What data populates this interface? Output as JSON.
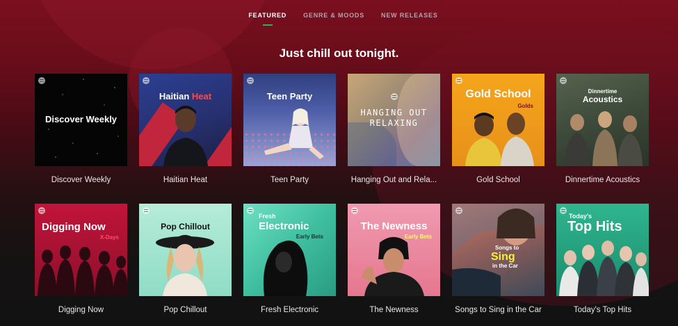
{
  "nav": {
    "tabs": [
      {
        "label": "FEATURED",
        "active": true
      },
      {
        "label": "GENRE & MOODS",
        "active": false
      },
      {
        "label": "NEW RELEASES",
        "active": false
      }
    ]
  },
  "headline": "Just chill out tonight.",
  "playlists": [
    {
      "name": "Discover Weekly",
      "cover_title": "Discover Weekly"
    },
    {
      "name": "Haitian Heat",
      "cover_title_a": "Haitian",
      "cover_title_b": "Heat"
    },
    {
      "name": "Teen Party",
      "cover_title": "Teen Party"
    },
    {
      "name": "Hanging Out and Rela...",
      "cover_title_a": "HANGING OUT",
      "cover_title_b": "RELAXING"
    },
    {
      "name": "Gold School",
      "cover_title": "Gold School",
      "cover_sub": "Golds"
    },
    {
      "name": "Dinnertime Acoustics",
      "cover_title_a": "Dinnertime",
      "cover_title_b": "Acoustics"
    },
    {
      "name": "Digging Now",
      "cover_title": "Digging Now",
      "cover_sub": "X-Days"
    },
    {
      "name": "Pop Chillout",
      "cover_title": "Pop Chillout"
    },
    {
      "name": "Fresh Electronic",
      "cover_title_a": "Fresh",
      "cover_title_b": "Electronic",
      "cover_sub": "Early Bets"
    },
    {
      "name": "The Newness",
      "cover_title": "The Newness",
      "cover_sub": "Early Bets"
    },
    {
      "name": "Songs to Sing in the Car",
      "cover_title_a": "Songs to",
      "cover_title_b": "Sing",
      "cover_title_c": "in the Car"
    },
    {
      "name": "Today's Top Hits",
      "cover_title_a": "Today's",
      "cover_title_b": "Top Hits"
    }
  ],
  "colors": {
    "accent": "#1db954",
    "background_top": "#7a0f1f",
    "background_bottom": "#121212"
  }
}
